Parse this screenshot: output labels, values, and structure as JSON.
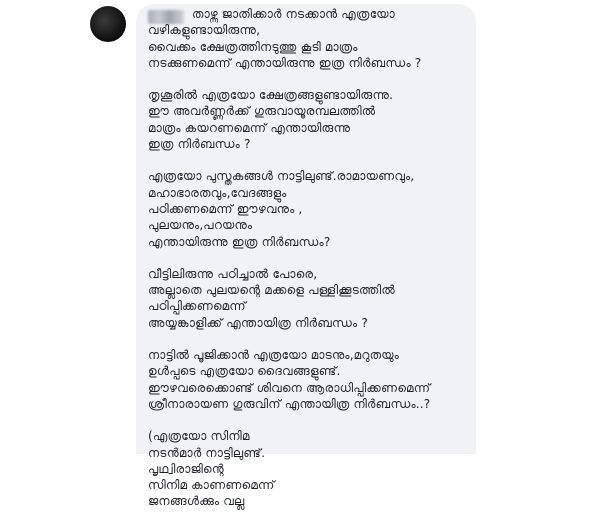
{
  "comment": {
    "author_name_redacted": true,
    "paragraphs": [
      [
        "താഴ്ന്ന ജാതിക്കാർ നടക്കാൻ എത്രയോ",
        "വഴികളുണ്ടായിരുന്നു,",
        "വൈക്കം ക്ഷേത്രത്തിനടുത്തു കൂടി മാത്രം",
        "നടക്കുണമെന്ന് എന്തായിരുന്നു ഇത്ര നിർബന്ധം ?"
      ],
      [
        "തൃശൂരിൽ എത്രയോ ക്ഷേത്രങ്ങളുണ്ടായിരുന്നു.",
        "ഈ അവർണ്ണർക്ക് ഗുരുവായൂരമ്പലത്തിൽ",
        "മാത്രം കയറണമെന്ന് എന്തായിരുന്നു",
        "ഇത്ര നിർബന്ധം ?"
      ],
      [
        "എത്രയോ പുസ്തകങ്ങൾ നാട്ടിലുണ്ട്.രാമായണവും,",
        "മഹാഭാരതവും,വേദങ്ങളും",
        "പഠിക്കണമെന്ന് ഈഴവനും ,",
        "പുലയനും,പറയനും",
        "എന്തായിരുന്നു ഇത്ര നിർബന്ധം?"
      ],
      [
        "വീട്ടിലിരുന്നു പഠിച്ചാൽ പോരെ,",
        "അല്ലാതെ പുലയന്റെ മക്കളെ പള്ളിക്കൂടത്തിൽ",
        "പഠിപ്പിക്കണമെന്ന്",
        "അയ്യങ്കാളിക്ക് എന്തായിത്ര നിർബന്ധം ?"
      ],
      [
        "നാട്ടിൽ പൂജിക്കാൻ എത്രയോ മാടനും,മറുതയും",
        "ഉൾപ്പടെ എത്രയോ ദൈവങ്ങളുണ്ട്.",
        "ഈഴവരെക്കൊണ്ട് ശിവനെ ആരാധിപ്പിക്കണമെന്ന്",
        "ശ്രീനാരായണ ഗുരുവിന് എന്തായിത്ര നിർബന്ധം..?"
      ],
      [
        "(എത്രയോ സിനിമ",
        "നടൻമാർ നാട്ടിലുണ്ട്.",
        "പൃഥ്വിരാജിന്റെ",
        "സിനിമ കാണണമെന്ന്",
        "ജനങ്ങൾക്കും വല്ല"
      ]
    ]
  }
}
